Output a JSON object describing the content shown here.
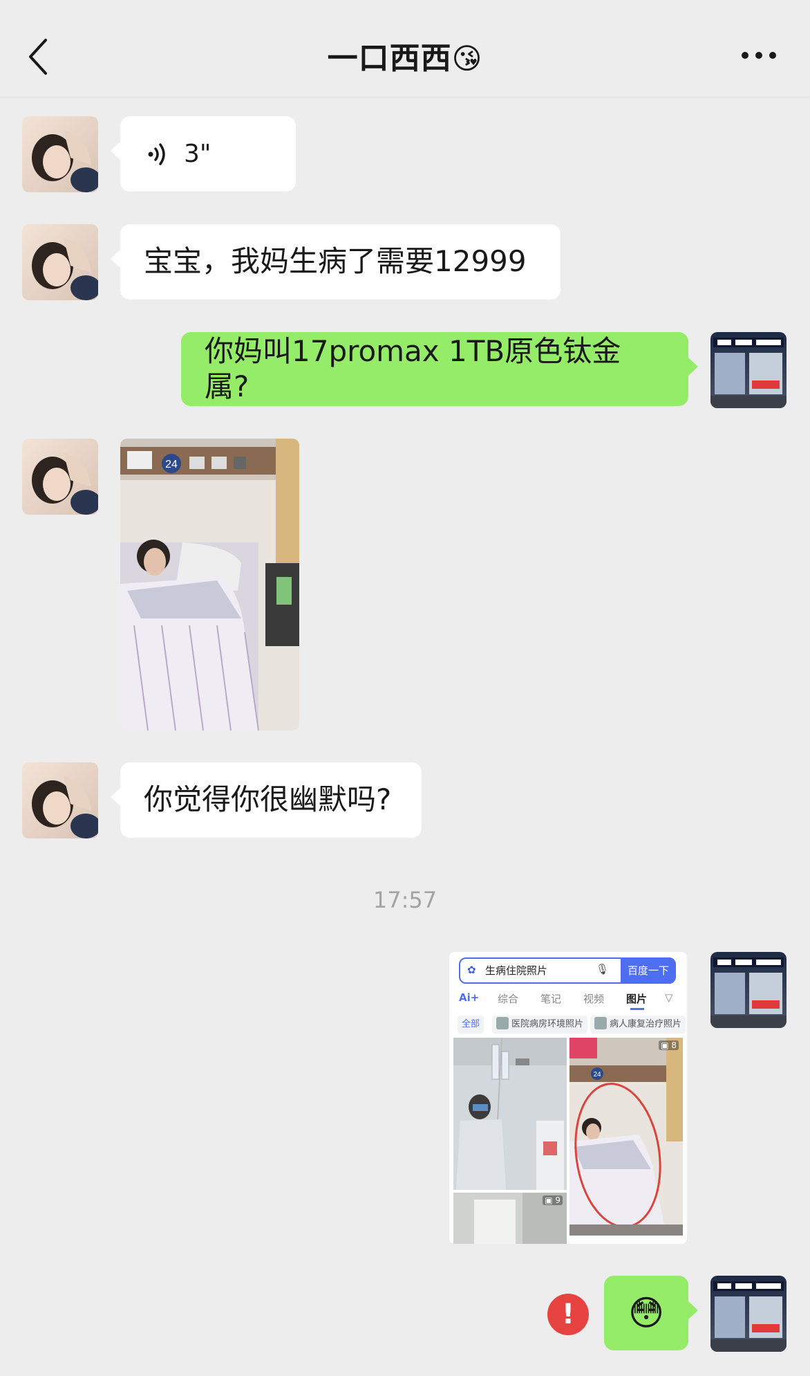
{
  "header": {
    "back_icon": "chevron-left-icon",
    "title": "一口西西",
    "title_emoji": "😘",
    "more_icon": "more-dots-icon"
  },
  "messages": [
    {
      "side": "in",
      "type": "voice",
      "duration": "3\""
    },
    {
      "side": "in",
      "type": "text",
      "text": "宝宝，我妈生病了需要12999"
    },
    {
      "side": "out",
      "type": "text",
      "text": "你妈叫17promax 1TB原色钛金属?"
    },
    {
      "side": "in",
      "type": "image",
      "description_label": "24"
    },
    {
      "side": "in",
      "type": "text",
      "text": "你觉得你很幽默吗?"
    },
    {
      "side": "out",
      "type": "image",
      "screenshot": {
        "search_query": "生病住院照片",
        "search_button": "百度一下",
        "tabs": [
          "Ai+",
          "综合",
          "笔记",
          "视频",
          "图片"
        ],
        "active_tab": "图片",
        "chips": [
          "全部",
          "医院病房环境照片",
          "病人康复治疗照片"
        ],
        "image_count": "8",
        "bed_number": "24"
      }
    },
    {
      "side": "out",
      "type": "emoji",
      "emoji": "😳",
      "status": "!"
    }
  ],
  "timestamp": "17:57",
  "colors": {
    "background": "#ededed",
    "incoming_bubble": "#ffffff",
    "outgoing_bubble": "#95ec69",
    "error": "#e64340"
  }
}
